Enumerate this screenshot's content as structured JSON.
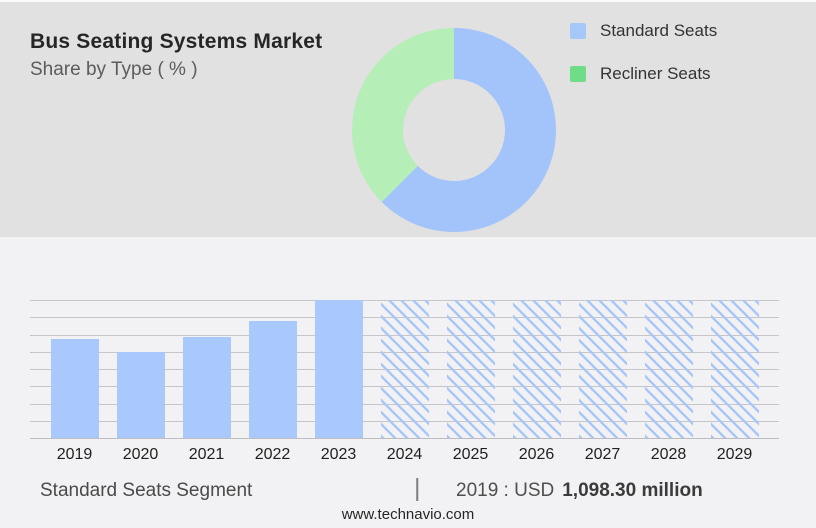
{
  "header": {
    "title": "Bus Seating Systems Market",
    "subtitle": "Share by Type ( % )"
  },
  "legend": {
    "items": [
      {
        "label": "Standard Seats",
        "color": "#a6c8f9"
      },
      {
        "label": "Recliner Seats",
        "color": "#6fdd88"
      }
    ]
  },
  "footer": {
    "segment_label": "Standard Seats Segment",
    "separator": "|",
    "stat_prefix": "2019 : USD",
    "stat_value": "1,098.30 million",
    "website": "www.technavio.com"
  },
  "chart_data": [
    {
      "type": "pie",
      "donut": true,
      "title": "Share by Type ( % )",
      "labels": [
        "Standard Seats",
        "Recliner Seats"
      ],
      "values": [
        62.5,
        37.5
      ],
      "values_note": "estimated from arc angles; no numeric labels shown in image",
      "colors": [
        "#a3c4fa",
        "#b5eeb6"
      ],
      "start_angle_deg": 0,
      "legend_position": "right"
    },
    {
      "type": "bar",
      "categories": [
        "2019",
        "2020",
        "2021",
        "2022",
        "2023",
        "2024",
        "2025",
        "2026",
        "2027",
        "2028",
        "2029"
      ],
      "values": [
        72,
        62,
        73,
        85,
        100,
        100,
        100,
        100,
        100,
        100,
        100
      ],
      "values_note": "relative bar heights, % of tallest bar; no y-axis labels shown",
      "is_forecast": [
        false,
        false,
        false,
        false,
        false,
        true,
        true,
        true,
        true,
        true,
        true
      ],
      "labeled_point": {
        "year": "2019",
        "value_text": "USD 1,098.30 million"
      },
      "bar_color": "#a9c8fb",
      "hatch_color": "#a9c8f7",
      "gridline_count": 9,
      "grid": true,
      "ylim": [
        0,
        100
      ]
    }
  ]
}
